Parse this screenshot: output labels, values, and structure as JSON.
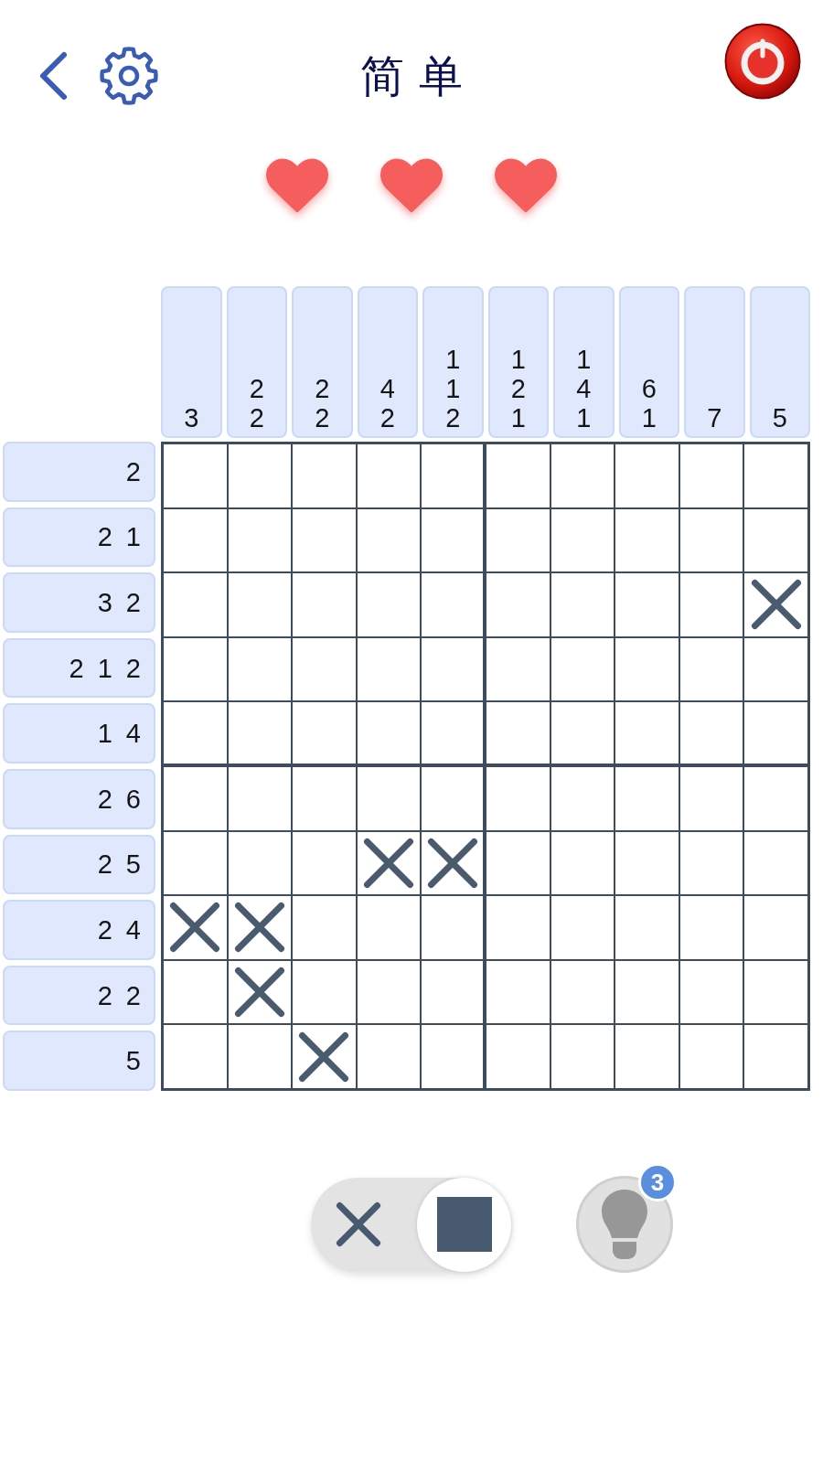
{
  "header": {
    "title": "简单"
  },
  "hearts": [
    {
      "filled": true
    },
    {
      "filled": true
    },
    {
      "filled": true
    }
  ],
  "column_clues": [
    [
      "3"
    ],
    [
      "2",
      "2"
    ],
    [
      "2",
      "2"
    ],
    [
      "4",
      "2"
    ],
    [
      "1",
      "1",
      "2"
    ],
    [
      "1",
      "2",
      "1"
    ],
    [
      "1",
      "4",
      "1"
    ],
    [
      "6",
      "1"
    ],
    [
      "7"
    ],
    [
      "5"
    ]
  ],
  "row_clues": [
    [
      "2"
    ],
    [
      "2",
      "1"
    ],
    [
      "3",
      "2"
    ],
    [
      "2",
      "1",
      "2"
    ],
    [
      "1",
      "4"
    ],
    [
      "2",
      "6"
    ],
    [
      "2",
      "5"
    ],
    [
      "2",
      "4"
    ],
    [
      "2",
      "2"
    ],
    [
      "5"
    ]
  ],
  "grid": {
    "crossed": [
      [
        false,
        false,
        false,
        false,
        false,
        false,
        false,
        false,
        false,
        false
      ],
      [
        false,
        false,
        false,
        false,
        false,
        false,
        false,
        false,
        false,
        false
      ],
      [
        false,
        false,
        false,
        false,
        false,
        false,
        false,
        false,
        false,
        true
      ],
      [
        false,
        false,
        false,
        false,
        false,
        false,
        false,
        false,
        false,
        false
      ],
      [
        false,
        false,
        false,
        false,
        false,
        false,
        false,
        false,
        false,
        false
      ],
      [
        false,
        false,
        false,
        false,
        false,
        false,
        false,
        false,
        false,
        false
      ],
      [
        false,
        false,
        false,
        true,
        true,
        false,
        false,
        false,
        false,
        false
      ],
      [
        true,
        true,
        false,
        false,
        false,
        false,
        false,
        false,
        false,
        false
      ],
      [
        false,
        true,
        false,
        false,
        false,
        false,
        false,
        false,
        false,
        false
      ],
      [
        false,
        false,
        true,
        false,
        false,
        false,
        false,
        false,
        false,
        false
      ]
    ]
  },
  "mode_toggle": {
    "options": [
      {
        "kind": "cross",
        "selected": false
      },
      {
        "kind": "fill",
        "selected": true
      }
    ]
  },
  "hint_button": {
    "badge": "3"
  }
}
